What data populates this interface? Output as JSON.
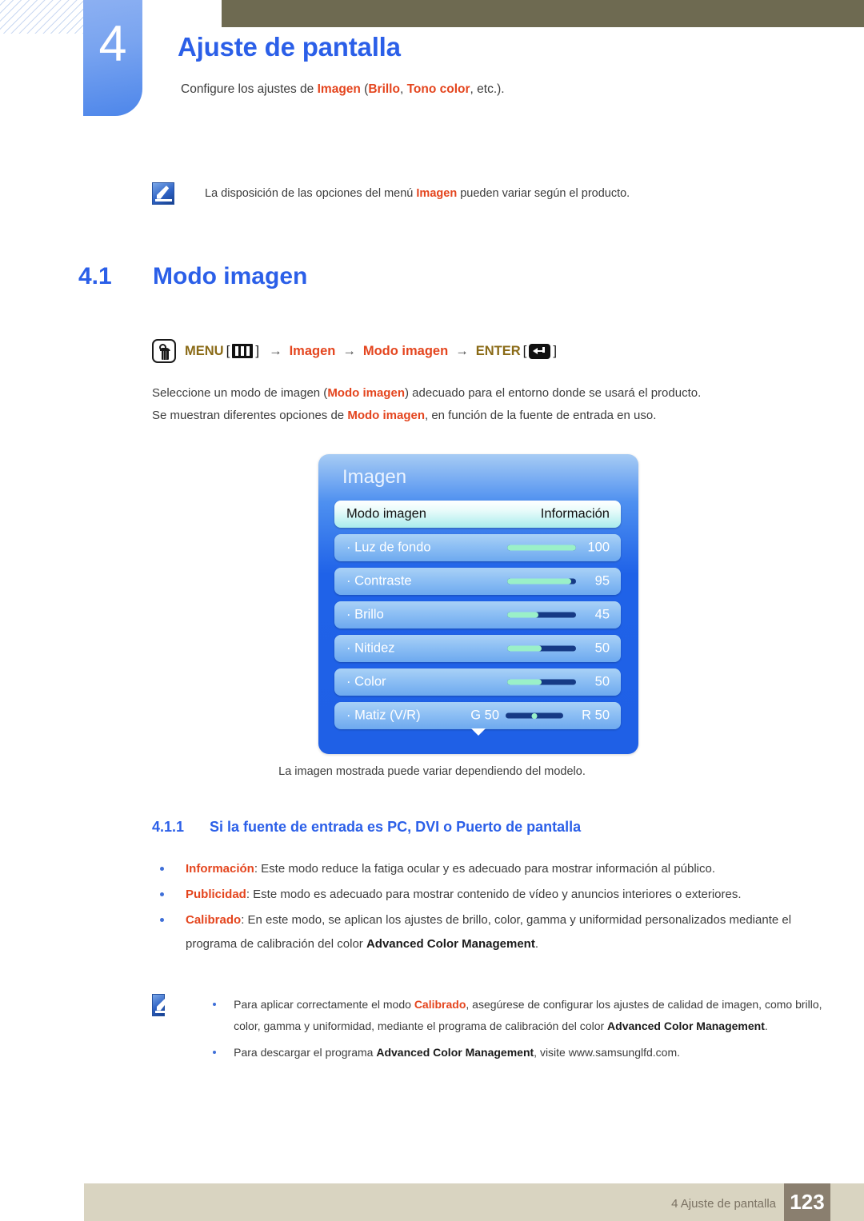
{
  "chapter": {
    "number": "4",
    "title": "Ajuste de pantalla",
    "subtitle_pre": "Configure los ajustes de ",
    "subtitle_kw1": "Imagen",
    "subtitle_mid1": " (",
    "subtitle_kw2": "Brillo",
    "subtitle_mid2": ", ",
    "subtitle_kw3": "Tono color",
    "subtitle_post": ", etc.)."
  },
  "note_top": {
    "icon": "note-pen-icon",
    "pre": "La disposición de las opciones del menú ",
    "kw": "Imagen",
    "post": " pueden variar según el producto."
  },
  "section": {
    "number": "4.1",
    "title": "Modo imagen"
  },
  "menu_path": {
    "hand_icon": "hand-press-icon",
    "menu_label": "MENU",
    "menu_icon": "menu-bars-icon",
    "arrow": "→",
    "item1": "Imagen",
    "item2": "Modo imagen",
    "enter_label": "ENTER",
    "enter_icon": "enter-key-icon",
    "bracket_open": "[",
    "bracket_close": "]"
  },
  "intro": {
    "line1_a": "Seleccione un modo de imagen (",
    "line1_kw": "Modo imagen",
    "line1_b": ") adecuado para el entorno donde se usará el producto.",
    "line2_a": "Se muestran diferentes opciones de ",
    "line2_kw": "Modo imagen",
    "line2_b": ", en función de la fuente de entrada en uso."
  },
  "osd": {
    "title": "Imagen",
    "scroll_indicator": "chevron-down-icon",
    "rows": [
      {
        "label": "Modo imagen",
        "value": "Información",
        "type": "select",
        "selected": true
      },
      {
        "label": "· Luz de fondo",
        "value": "100",
        "type": "slider",
        "fill_pct": 100
      },
      {
        "label": "· Contraste",
        "value": "95",
        "type": "slider",
        "fill_pct": 95
      },
      {
        "label": "· Brillo",
        "value": "45",
        "type": "slider",
        "fill_pct": 45
      },
      {
        "label": "· Nitidez",
        "value": "50",
        "type": "slider",
        "fill_pct": 50
      },
      {
        "label": "· Color",
        "value": "50",
        "type": "slider",
        "fill_pct": 50
      },
      {
        "label": "· Matiz (V/R)",
        "value": "R 50",
        "type": "balance",
        "left_value": "G 50"
      }
    ]
  },
  "caption": "La imagen mostrada puede variar dependiendo del modelo.",
  "subsection": {
    "number": "4.1.1",
    "title": "Si la fuente de entrada es PC, DVI o Puerto de pantalla"
  },
  "bullets": [
    {
      "term": "Información",
      "text": ": Este modo reduce la fatiga ocular y es adecuado para mostrar información al público."
    },
    {
      "term": "Publicidad",
      "text": ": Este modo es adecuado para mostrar contenido de vídeo y anuncios interiores o exteriores."
    },
    {
      "term": "Calibrado",
      "text_a": ": En este modo, se aplican los ajustes de brillo, color, gamma y uniformidad personalizados mediante el programa de calibración del color ",
      "bold": "Advanced Color Management",
      "text_b": "."
    }
  ],
  "note_bottom": {
    "icon": "note-pen-icon",
    "items": [
      {
        "a": "Para aplicar correctamente el modo ",
        "kw": "Calibrado",
        "b": ", asegúrese de configurar los ajustes de calidad de imagen, como brillo, color, gamma y uniformidad, mediante el programa de calibración del color ",
        "bold": "Advanced Color Management",
        "c": "."
      },
      {
        "a": "Para descargar el programa ",
        "bold": "Advanced Color Management",
        "b": ", visite www.samsunglfd.com.",
        "kw": "",
        "c": ""
      }
    ]
  },
  "footer": {
    "text": "4 Ajuste de pantalla",
    "page": "123"
  },
  "colors": {
    "accent_blue": "#2b5fe8",
    "keyword_orange": "#e4451e",
    "olive": "#8a6a16",
    "topbar": "#6e6a51",
    "footer_bar": "#d9d4c1",
    "footer_page": "#8a7f6f"
  }
}
